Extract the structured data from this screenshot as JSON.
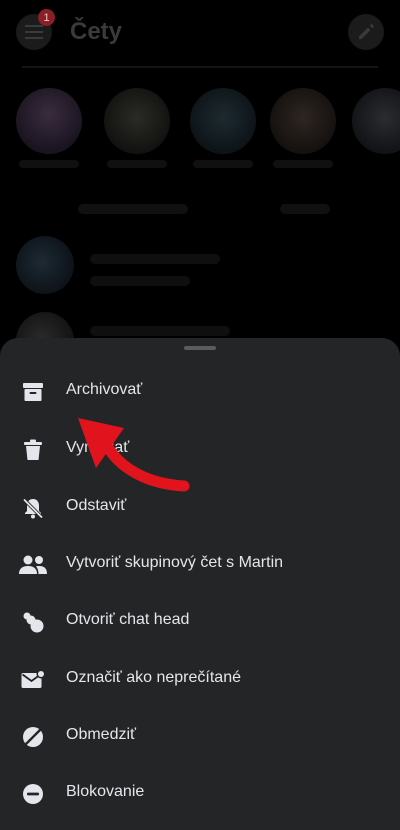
{
  "header": {
    "title": "Čety",
    "badge_count": "1"
  },
  "sheet": {
    "items": [
      {
        "label": "Archivovať",
        "icon": "archive-icon"
      },
      {
        "label": "Vymazať",
        "icon": "trash-icon"
      },
      {
        "label": "Odstaviť",
        "icon": "bell-off-icon"
      },
      {
        "label": "Vytvoriť skupinový čet s Martin",
        "icon": "group-icon"
      },
      {
        "label": "Otvoriť chat head",
        "icon": "chat-head-icon"
      },
      {
        "label": "Označiť ako neprečítané",
        "icon": "mail-unread-icon"
      },
      {
        "label": "Obmedziť",
        "icon": "restrict-icon"
      },
      {
        "label": "Blokovanie",
        "icon": "block-icon"
      }
    ]
  },
  "colors": {
    "sheet_bg": "#242526",
    "text": "#e4e6eb",
    "arrow": "#e1141e",
    "badge": "#8a1f28"
  }
}
